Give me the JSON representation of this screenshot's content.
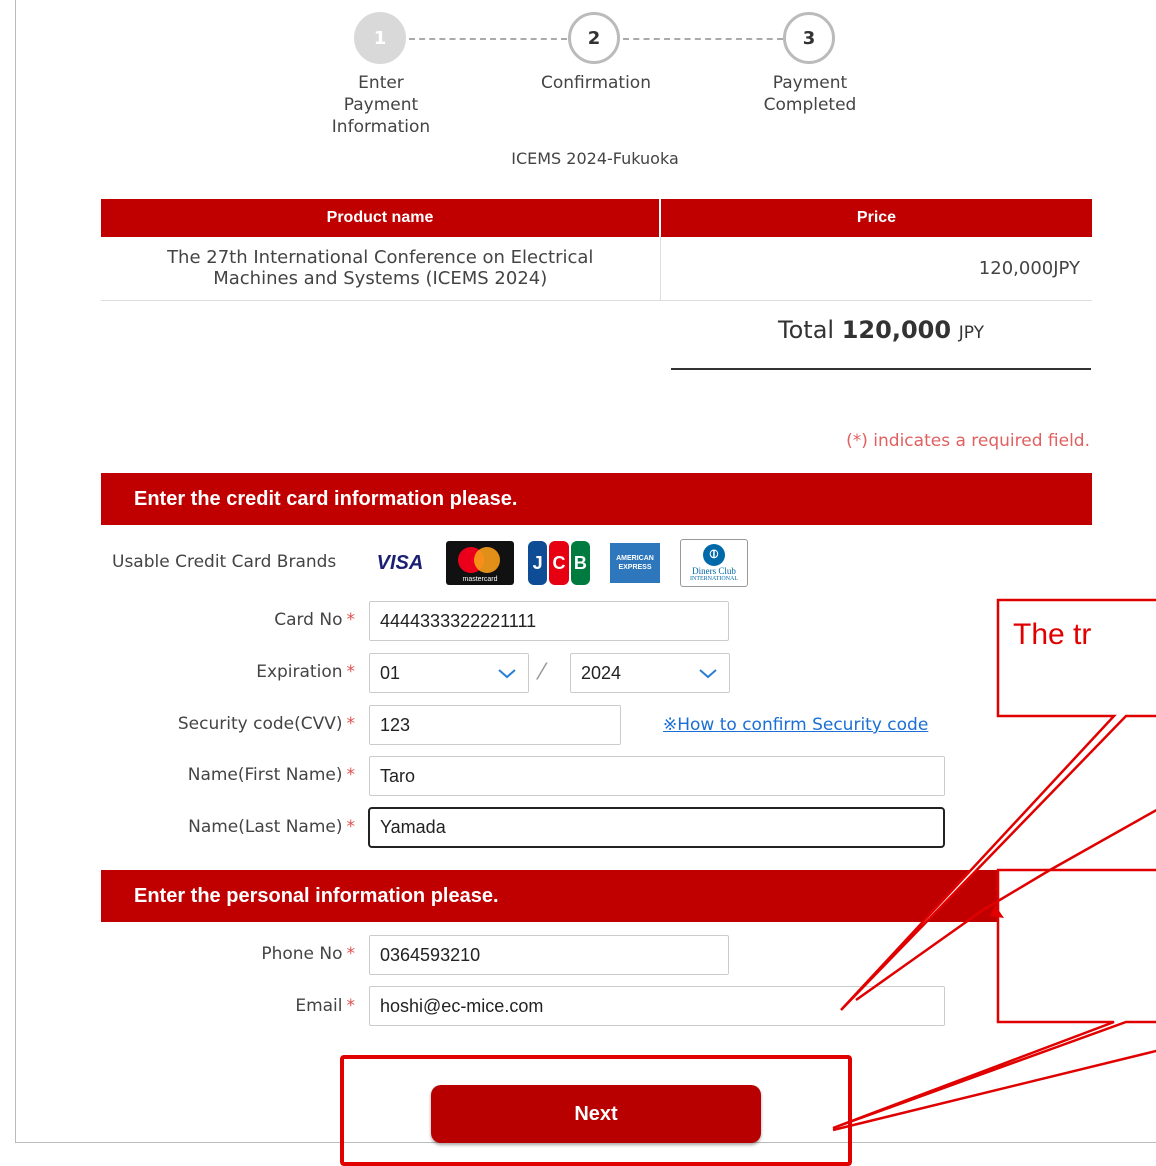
{
  "steps": [
    {
      "number": "1",
      "label": "Enter\nPayment\nInformation"
    },
    {
      "number": "2",
      "label": "Confirmation"
    },
    {
      "number": "3",
      "label": "Payment\nCompleted"
    }
  ],
  "event_title": "ICEMS 2024-Fukuoka",
  "product_table": {
    "headers": [
      "Product name",
      "Price"
    ],
    "rows": [
      {
        "name": "The 27th International Conference on Electrical Machines and Systems (ICEMS 2024)",
        "price": "120,000JPY"
      }
    ]
  },
  "total": {
    "label": "Total",
    "amount": "120,000",
    "currency": "JPY"
  },
  "required_note": "(*) indicates a required field.",
  "card_section": {
    "title": "Enter the credit card information please.",
    "brands_label": "Usable Credit Card Brands",
    "brands": {
      "visa": "VISA",
      "mastercard": "mastercard",
      "jcb": [
        "J",
        "C",
        "B"
      ],
      "amex": "AMERICAN EXPRESS",
      "diners": "Diners Club",
      "diners_sub": "INTERNATIONAL"
    },
    "card_no_label": "Card No",
    "card_no_value": "4444333322221111",
    "expiration_label": "Expiration",
    "exp_month": "01",
    "exp_year": "2024",
    "cvv_label": "Security code(CVV)",
    "cvv_value": "123",
    "cvv_help": "※How to confirm Security code",
    "first_name_label": "Name(First Name)",
    "first_name_value": "Taro",
    "last_name_label": "Name(Last Name)",
    "last_name_value": "Yamada"
  },
  "personal_section": {
    "title": "Enter the personal information please.",
    "phone_label": "Phone No",
    "phone_value": "0364593210",
    "email_label": "Email",
    "email_value": "hoshi@ec-mice.com"
  },
  "required_marker": "*",
  "next_button": "Next",
  "annotation": {
    "callout_text": "The tr"
  },
  "colors": {
    "brand_red": "#c00000",
    "button_red": "#b80000",
    "annotation_red": "#e00000",
    "link_blue": "#1a6fd6"
  }
}
